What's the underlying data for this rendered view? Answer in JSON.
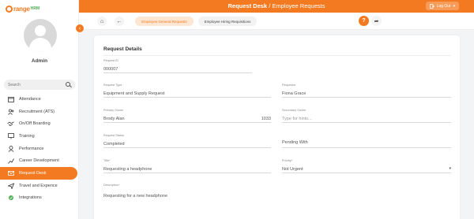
{
  "brand": {
    "name_part1": "range",
    "name_part2": "HRM"
  },
  "header": {
    "title_bold": "Request Desk",
    "title_rest": " / Employee Requests",
    "logout_label": "Log Out",
    "logout_caret": "▾"
  },
  "user": {
    "name": "Admin"
  },
  "sidebar": {
    "search_placeholder": "Search",
    "collapse_icon": "‹",
    "items": [
      {
        "label": "Attendance",
        "icon": "calendar-icon"
      },
      {
        "label": "Recruitment (ATS)",
        "icon": "users-icon"
      },
      {
        "label": "On/Off Boarding",
        "icon": "handshake-icon"
      },
      {
        "label": "Training",
        "icon": "training-icon"
      },
      {
        "label": "Performance",
        "icon": "performance-icon"
      },
      {
        "label": "Career Development",
        "icon": "career-icon"
      },
      {
        "label": "Request Desk",
        "icon": "request-icon",
        "active": true
      },
      {
        "label": "Travel and Expence",
        "icon": "plane-icon"
      },
      {
        "label": "Integrations",
        "icon": "integrations-icon"
      }
    ]
  },
  "toolbar": {
    "home_icon": "⌂",
    "back_icon": "←",
    "tabs": [
      {
        "label": "Employee General Requests",
        "active": true
      },
      {
        "label": "Employee Hiring Requisitions",
        "active": false
      }
    ],
    "help_label": "?",
    "share_icon": "➦"
  },
  "form": {
    "heading": "Request Details",
    "request_id": {
      "label": "Request ID",
      "value": "000007"
    },
    "request_type": {
      "label": "Request Type",
      "value": "Equipment and Supply Request"
    },
    "requestor": {
      "label": "Requestor",
      "value": "Fiona Grace"
    },
    "primary_owner": {
      "label": "Primary Owner",
      "value": "Brody Alan",
      "number": "1033"
    },
    "secondary_owner": {
      "label": "Secondary Owner",
      "placeholder": "Type for hints..."
    },
    "request_status": {
      "label": "Request Status",
      "value": "Completed"
    },
    "pending_with": {
      "label": "Pending With",
      "value": ""
    },
    "title": {
      "label": "Title*",
      "value": "Requesting a headphone"
    },
    "priority": {
      "label": "Priority*",
      "value": "Not Urgent",
      "caret": "▾"
    },
    "description": {
      "label": "Description*",
      "value": "Requesting for a new headphone"
    }
  },
  "colors": {
    "accent": "#f37a20",
    "brand_green": "#4caf50"
  }
}
